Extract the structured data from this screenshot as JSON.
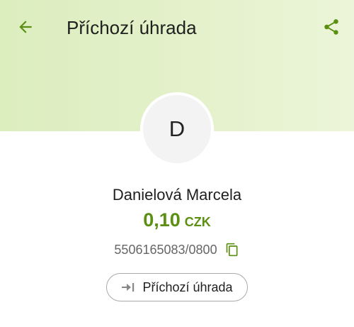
{
  "header": {
    "title": "Příchozí úhrada",
    "back_icon": "arrow-left-icon",
    "share_icon": "share-icon"
  },
  "counterparty": {
    "initial": "D",
    "name": "Danielová Marcela",
    "amount": "0,10",
    "currency": "CZK",
    "account_number": "5506165083/0800",
    "copy_icon": "copy-icon"
  },
  "transaction_type": {
    "label": "Příchozí úhrada",
    "icon": "incoming-arrow-icon"
  },
  "colors": {
    "accent": "#5b8f12",
    "header_bg": "#e1efc6",
    "text_primary": "#1f1f1f",
    "text_secondary": "#666666"
  }
}
